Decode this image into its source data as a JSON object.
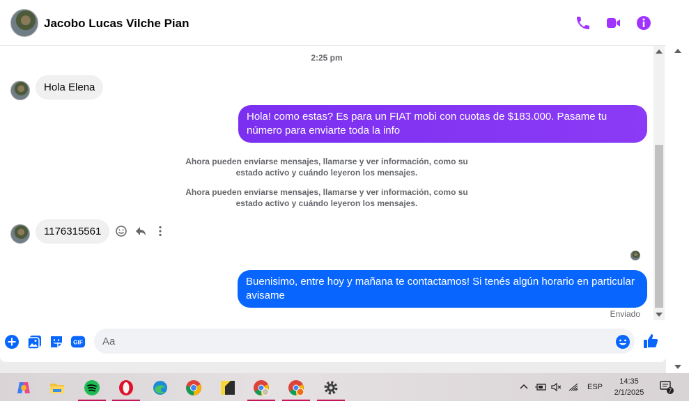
{
  "header": {
    "contact_name": "Jacobo Lucas Vilche Pian",
    "icons": [
      "phone-icon",
      "video-icon",
      "info-icon"
    ],
    "accent_color": "#a033ff"
  },
  "thread": {
    "timestamp": "2:25 pm",
    "msg1": "Hola Elena",
    "msg2": "Hola! como estas? Es para un FIAT mobi con cuotas de $183.000. Pasame tu número para enviarte toda la info",
    "system_note_1": "Ahora pueden enviarse mensajes, llamarse y ver información, como su estado activo y cuándo leyeron los mensajes.",
    "system_note_2": "Ahora pueden enviarse mensajes, llamarse y ver información, como su estado activo y cuándo leyeron los mensajes.",
    "msg3": "1176315561",
    "msg4": "Buenisimo, entre hoy y mañana te contactamos! Si tenés algún horario en particular avisame",
    "status": "Enviado"
  },
  "composer": {
    "placeholder": "Aa",
    "gif_label": "GIF",
    "icons": [
      "plus-icon",
      "photo-icon",
      "sticker-icon",
      "gif-icon",
      "emoji-icon",
      "thumbs-up-icon"
    ]
  },
  "taskbar": {
    "apps": [
      "copilot-icon",
      "file-explorer-icon",
      "spotify-icon",
      "opera-icon",
      "edge-icon",
      "chrome-icon",
      "sticky-notes-icon",
      "chrome-profile-icon",
      "chrome-profile-2-icon",
      "settings-icon"
    ],
    "language": "ESP",
    "time": "14:35",
    "date": "2/1/2025",
    "notification_count": "7"
  }
}
